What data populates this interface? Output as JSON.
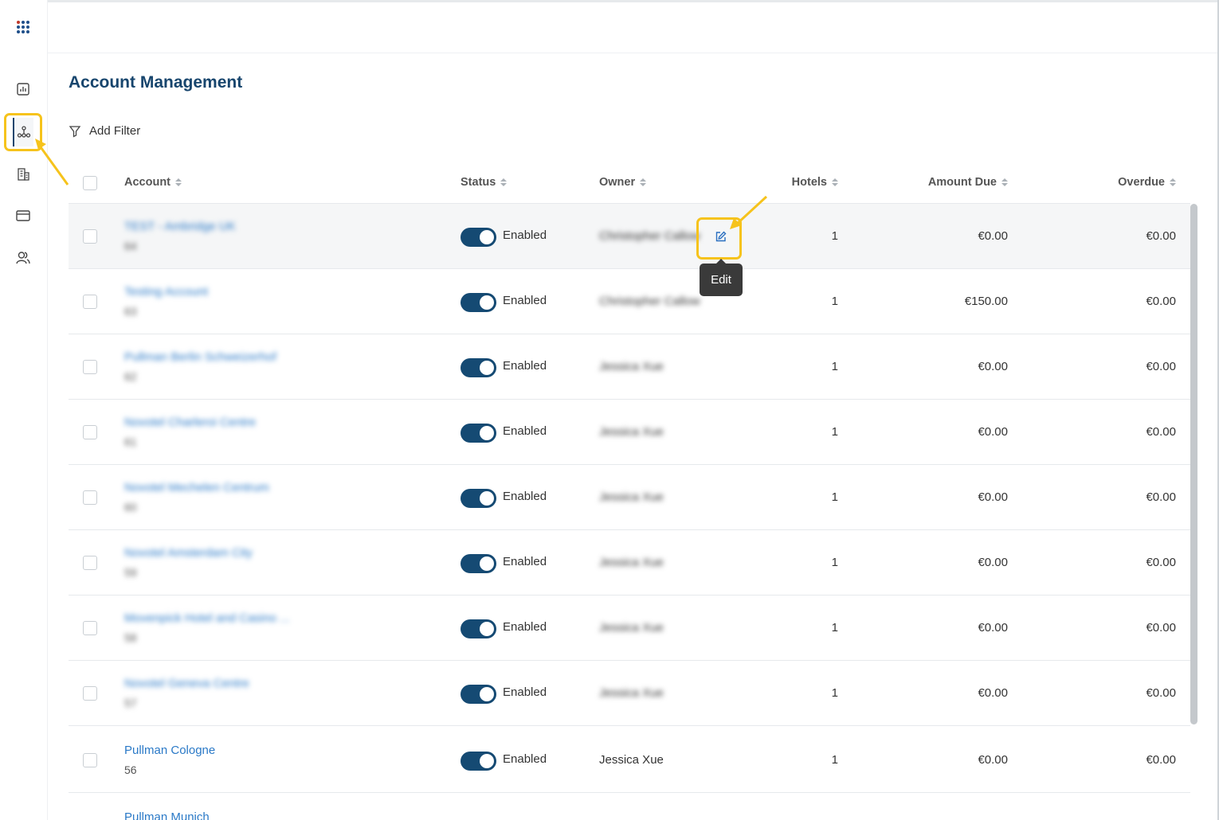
{
  "app": {
    "title": "Account Management",
    "add_filter_label": "Add Filter"
  },
  "sidebar": {
    "items": [
      {
        "name": "apps-grid-icon"
      },
      {
        "name": "report-chart-icon"
      },
      {
        "name": "hierarchy-icon",
        "active": true
      },
      {
        "name": "building-icon"
      },
      {
        "name": "card-icon"
      },
      {
        "name": "users-icon"
      }
    ]
  },
  "table": {
    "columns": {
      "account": "Account",
      "status": "Status",
      "owner": "Owner",
      "hotels": "Hotels",
      "amount_due": "Amount Due",
      "overdue": "Overdue"
    },
    "rows": [
      {
        "account": "TEST - Ambridge UK",
        "id": "64",
        "status": "Enabled",
        "owner": "Christopher Callow",
        "hotels": "1",
        "amount_due": "€0.00",
        "overdue": "€0.00"
      },
      {
        "account": "Testing Account",
        "id": "63",
        "status": "Enabled",
        "owner": "Christopher Callow",
        "hotels": "1",
        "amount_due": "€150.00",
        "overdue": "€0.00"
      },
      {
        "account": "Pullman Berlin Schweizerhof",
        "id": "62",
        "status": "Enabled",
        "owner": "Jessica Xue",
        "hotels": "1",
        "amount_due": "€0.00",
        "overdue": "€0.00"
      },
      {
        "account": "Novotel Charleroi Centre",
        "id": "61",
        "status": "Enabled",
        "owner": "Jessica Xue",
        "hotels": "1",
        "amount_due": "€0.00",
        "overdue": "€0.00"
      },
      {
        "account": "Novotel Mechelen Centrum",
        "id": "60",
        "status": "Enabled",
        "owner": "Jessica Xue",
        "hotels": "1",
        "amount_due": "€0.00",
        "overdue": "€0.00"
      },
      {
        "account": "Novotel Amsterdam City",
        "id": "59",
        "status": "Enabled",
        "owner": "Jessica Xue",
        "hotels": "1",
        "amount_due": "€0.00",
        "overdue": "€0.00"
      },
      {
        "account": "Movenpick Hotel and Casino ...",
        "id": "58",
        "status": "Enabled",
        "owner": "Jessica Xue",
        "hotels": "1",
        "amount_due": "€0.00",
        "overdue": "€0.00"
      },
      {
        "account": "Novotel Geneva Centre",
        "id": "57",
        "status": "Enabled",
        "owner": "Jessica Xue",
        "hotels": "1",
        "amount_due": "€0.00",
        "overdue": "€0.00"
      },
      {
        "account": "Pullman Cologne",
        "id": "56",
        "status": "Enabled",
        "owner": "Jessica Xue",
        "hotels": "1",
        "amount_due": "€0.00",
        "overdue": "€0.00"
      },
      {
        "account": "Pullman Munich",
        "id": "",
        "status": "",
        "owner": "",
        "hotels": "",
        "amount_due": "",
        "overdue": ""
      }
    ]
  },
  "tooltip": {
    "edit": "Edit"
  },
  "colors": {
    "brand": "#17456d",
    "link": "#2a79c7",
    "toggle": "#154a73",
    "highlight": "#f6c31c"
  }
}
